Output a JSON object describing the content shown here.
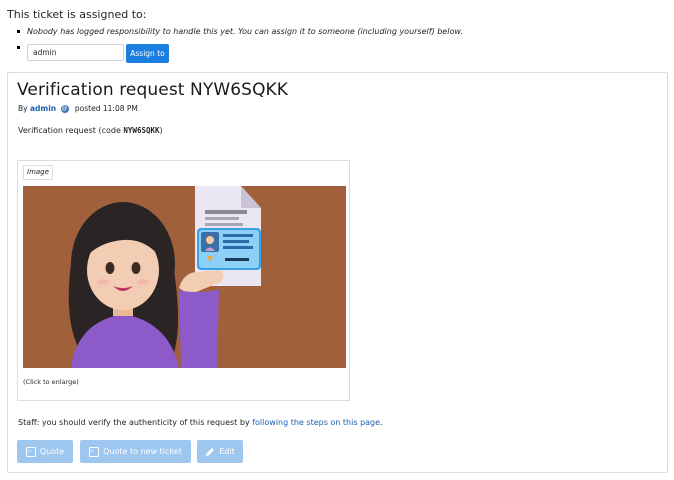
{
  "assignment": {
    "title": "This ticket is assigned to:",
    "nobody_note": "Nobody has logged responsibility to handle this yet. You can assign it to someone (including yourself) below.",
    "input_value": "admin",
    "assign_button": "Assign to"
  },
  "ticket": {
    "title": "Verification request NYW6SQKK",
    "by_label": "By",
    "author": "admin",
    "posted_label": "posted 11:08 PM",
    "body_prefix": "Verification request (code ",
    "body_code": "NYW6SQKK",
    "body_suffix": ")",
    "image_label": "Image",
    "image_hint": "(Click to enlarge)",
    "staff_note_prefix": "Staff: you should verify the authenticity of this request by ",
    "staff_note_link": "following the steps on this page",
    "staff_note_suffix": "."
  },
  "actions": {
    "quote": "Quote",
    "quote_new": "Quote to new ticket",
    "edit": "Edit"
  },
  "colors": {
    "primary": "#1a7fe0",
    "disabled_button": "#9ec7f0",
    "link": "#1a5fb4",
    "image_background": "#a0603c"
  },
  "icons": [
    "at-icon",
    "quote-icon",
    "quote-new-icon",
    "pencil-icon"
  ]
}
